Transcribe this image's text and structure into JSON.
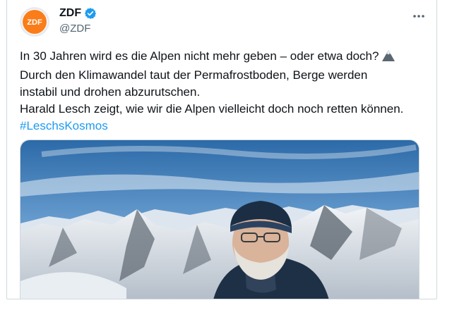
{
  "account": {
    "name": "ZDF",
    "handle": "@ZDF",
    "logo_text": "ZDF",
    "verified": true,
    "brand_color": "#fa7d19",
    "verified_color": "#1d9bf0"
  },
  "post": {
    "lines": [
      "In 30 Jahren wird es die Alpen nicht mehr geben – oder etwa doch?",
      "Durch den Klimawandel taut der Permafrostboden, Berge werden",
      "instabil und drohen abzurutschen.",
      "Harald Lesch zeigt, wie wir die Alpen vielleicht doch noch retten können."
    ],
    "emoji": "mountain-emoji",
    "hashtag": "#LeschsKosmos",
    "hashtag_color": "#1d9bf0"
  },
  "icons": {
    "more": "more-options-icon",
    "verified": "verified-badge-icon"
  },
  "media": {
    "description_icon": "video-thumbnail"
  }
}
